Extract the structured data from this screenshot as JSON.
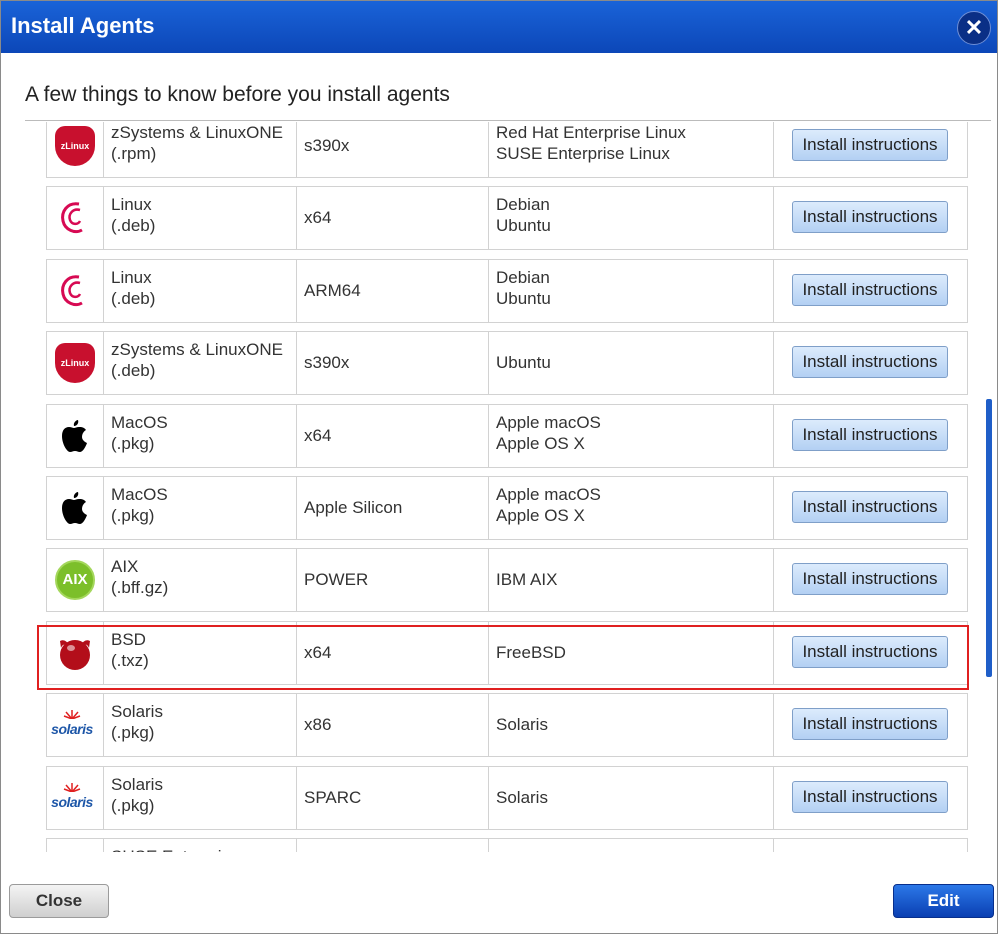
{
  "dialog": {
    "title": "Install Agents",
    "close_icon": "close-icon",
    "intro": "A few things to know before you install agents"
  },
  "agents": [
    {
      "icon": "zlinux-icon",
      "icon_text": "zLinux",
      "name": "zSystems & LinuxONE",
      "package": "(.rpm)",
      "arch": "s390x",
      "os1": "Red Hat Enterprise Linux",
      "os2": "SUSE Enterprise Linux",
      "button": "Install instructions"
    },
    {
      "icon": "debian-icon",
      "name": "Linux",
      "package": "(.deb)",
      "arch": "x64",
      "os1": "Debian",
      "os2": "Ubuntu",
      "button": "Install instructions"
    },
    {
      "icon": "debian-icon",
      "name": "Linux",
      "package": "(.deb)",
      "arch": "ARM64",
      "os1": "Debian",
      "os2": "Ubuntu",
      "button": "Install instructions"
    },
    {
      "icon": "zlinux-icon",
      "icon_text": "zLinux",
      "name": "zSystems & LinuxONE",
      "package": "(.deb)",
      "arch": "s390x",
      "os1": "Ubuntu",
      "os2": "",
      "button": "Install instructions"
    },
    {
      "icon": "apple-icon",
      "name": "MacOS",
      "package": "(.pkg)",
      "arch": "x64",
      "os1": "Apple macOS",
      "os2": "Apple OS X",
      "button": "Install instructions"
    },
    {
      "icon": "apple-icon",
      "name": "MacOS",
      "package": "(.pkg)",
      "arch": "Apple Silicon",
      "os1": "Apple macOS",
      "os2": "Apple OS X",
      "button": "Install instructions"
    },
    {
      "icon": "aix-icon",
      "icon_text": "AIX",
      "name": "AIX",
      "package": "(.bff.gz)",
      "arch": "POWER",
      "os1": "IBM AIX",
      "os2": "",
      "button": "Install instructions"
    },
    {
      "icon": "freebsd-icon",
      "name": "BSD",
      "package": "(.txz)",
      "arch": "x64",
      "os1": "FreeBSD",
      "os2": "",
      "button": "Install instructions",
      "highlighted": true
    },
    {
      "icon": "solaris-icon",
      "icon_text": "solaris",
      "name": "Solaris",
      "package": "(.pkg)",
      "arch": "x86",
      "os1": "Solaris",
      "os2": "",
      "button": "Install instructions"
    },
    {
      "icon": "solaris-icon",
      "icon_text": "solaris",
      "name": "Solaris",
      "package": "(.pkg)",
      "arch": "SPARC",
      "os1": "Solaris",
      "os2": "",
      "button": "Install instructions"
    },
    {
      "icon": "suse-icon",
      "name": "SUSE Enterprise",
      "package": "",
      "arch": "",
      "os1": "",
      "os2": "",
      "button": ""
    }
  ],
  "footer": {
    "close_label": "Close",
    "edit_label": "Edit"
  },
  "colors": {
    "titlebar": "#1a63d8",
    "highlight_border": "#e02020",
    "edit_button": "#0a3fb2"
  }
}
